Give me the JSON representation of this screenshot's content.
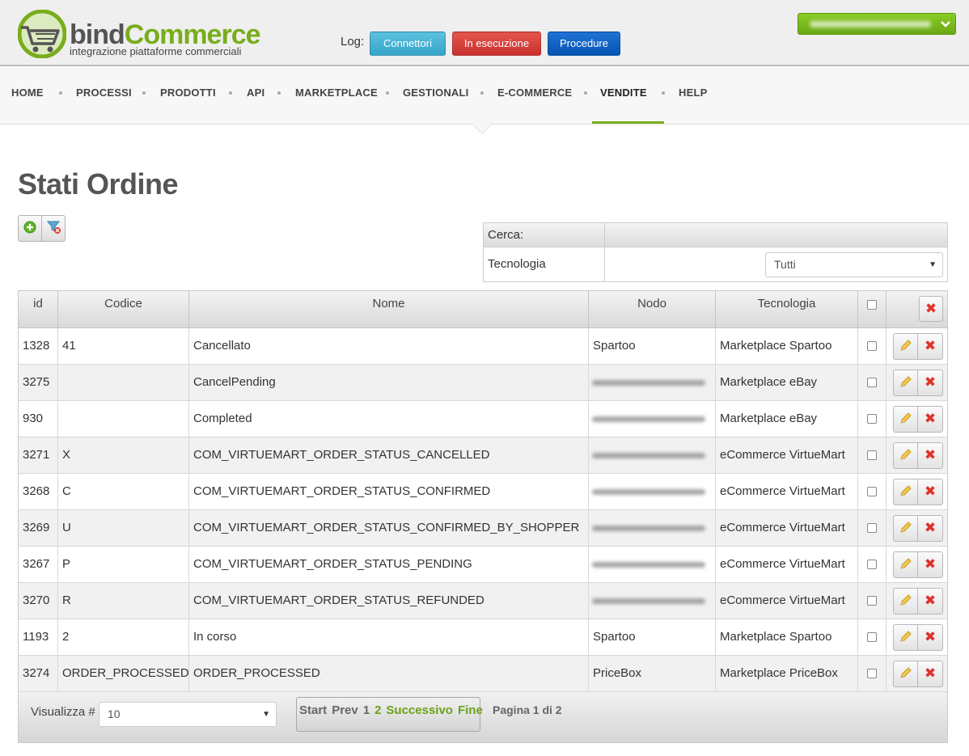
{
  "header": {
    "logo": {
      "name_part1": "bind",
      "name_part2": "Commerce",
      "tagline": "integrazione piattaforme commerciali"
    },
    "log_label": "Log:",
    "log_buttons": {
      "connettori": "Connettori",
      "in_esecuzione": "In esecuzione",
      "procedure": "Procedure"
    },
    "user_menu": {
      "icon": "chevron-down-icon",
      "color": "#79ad1c"
    }
  },
  "nav": {
    "items": [
      "HOME",
      "PROCESSI",
      "PRODOTTI",
      "API",
      "MARKETPLACE",
      "GESTIONALI",
      "E-COMMERCE",
      "VENDITE",
      "HELP"
    ],
    "active": "VENDITE"
  },
  "page": {
    "title": "Stati Ordine"
  },
  "toolbar": {
    "add_icon": "add-icon",
    "filter_icon": "filter-remove-icon"
  },
  "search": {
    "header": "Cerca:",
    "tecnologia_label": "Tecnologia",
    "tecnologia_value": "Tutti"
  },
  "table": {
    "columns": [
      "id",
      "Codice",
      "Nome",
      "Nodo",
      "Tecnologia"
    ],
    "rows": [
      {
        "id": "1328",
        "codice": "41",
        "nome": "Cancellato",
        "nodo": "Spartoo",
        "tecnologia": "Marketplace Spartoo"
      },
      {
        "id": "3275",
        "codice": "",
        "nome": "CancelPending",
        "nodo": "",
        "tecnologia": "Marketplace eBay"
      },
      {
        "id": "930",
        "codice": "",
        "nome": "Completed",
        "nodo": "",
        "tecnologia": "Marketplace eBay"
      },
      {
        "id": "3271",
        "codice": "X",
        "nome": "COM_VIRTUEMART_ORDER_STATUS_CANCELLED",
        "nodo": "",
        "tecnologia": "eCommerce VirtueMart"
      },
      {
        "id": "3268",
        "codice": "C",
        "nome": "COM_VIRTUEMART_ORDER_STATUS_CONFIRMED",
        "nodo": "",
        "tecnologia": "eCommerce VirtueMart"
      },
      {
        "id": "3269",
        "codice": "U",
        "nome": "COM_VIRTUEMART_ORDER_STATUS_CONFIRMED_BY_SHOPPER",
        "nodo": "",
        "tecnologia": "eCommerce VirtueMart"
      },
      {
        "id": "3267",
        "codice": "P",
        "nome": "COM_VIRTUEMART_ORDER_STATUS_PENDING",
        "nodo": "",
        "tecnologia": "eCommerce VirtueMart"
      },
      {
        "id": "3270",
        "codice": "R",
        "nome": "COM_VIRTUEMART_ORDER_STATUS_REFUNDED",
        "nodo": "",
        "tecnologia": "eCommerce VirtueMart"
      },
      {
        "id": "1193",
        "codice": "2",
        "nome": "In corso",
        "nodo": "Spartoo",
        "tecnologia": "Marketplace Spartoo"
      },
      {
        "id": "3274",
        "codice": "ORDER_PROCESSED",
        "nome": "ORDER_PROCESSED",
        "nodo": "PriceBox",
        "tecnologia": "Marketplace PriceBox"
      }
    ]
  },
  "footer": {
    "visualizza_label": "Visualizza #",
    "visualizza_value": "10",
    "pager": {
      "start": "Start",
      "prev": "Prev",
      "page1": "1",
      "page2": "2",
      "next": "Successivo",
      "last": "Fine"
    },
    "page_info": "Pagina 1 di 2"
  }
}
